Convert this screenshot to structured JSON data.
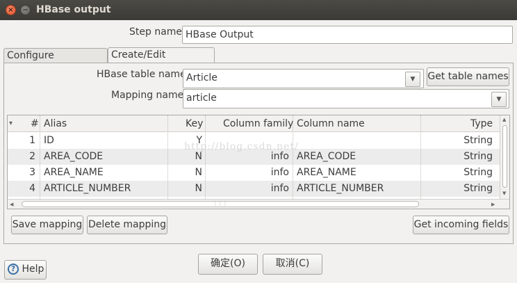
{
  "window": {
    "title": "HBase output",
    "close_icon": "×",
    "minimize_icon": "−"
  },
  "step": {
    "label": "Step name",
    "value": "HBase Output"
  },
  "tabs": [
    {
      "label": "Configure connection"
    },
    {
      "label": "Create/Edit mappings"
    }
  ],
  "mapping": {
    "table_label": "HBase table name",
    "table_value": "Article",
    "get_table_names": "Get table names",
    "mapping_label": "Mapping name",
    "mapping_value": "article"
  },
  "table": {
    "headers": {
      "sort": "▾",
      "num": "#",
      "alias": "Alias",
      "key": "Key",
      "family": "Column family",
      "colname": "Column name",
      "type": "Type"
    },
    "rows": [
      {
        "num": "1",
        "alias": "ID",
        "key": "Y",
        "family": "",
        "colname": "",
        "type": "String"
      },
      {
        "num": "2",
        "alias": "AREA_CODE",
        "key": "N",
        "family": "info",
        "colname": "AREA_CODE",
        "type": "String"
      },
      {
        "num": "3",
        "alias": "AREA_NAME",
        "key": "N",
        "family": "info",
        "colname": "AREA_NAME",
        "type": "String"
      },
      {
        "num": "4",
        "alias": "ARTICLE_NUMBER",
        "key": "N",
        "family": "info",
        "colname": "ARTICLE_NUMBER",
        "type": "String"
      }
    ],
    "watermark": "http://blog.csdn.net/"
  },
  "buttons": {
    "save_mapping": "Save mapping",
    "delete_mapping": "Delete mapping",
    "get_incoming": "Get incoming fields",
    "ok": "确定(O)",
    "cancel": "取消(C)",
    "help": "Help"
  },
  "icons": {
    "dropdown": "chevron-down-icon",
    "help": "help-icon"
  }
}
